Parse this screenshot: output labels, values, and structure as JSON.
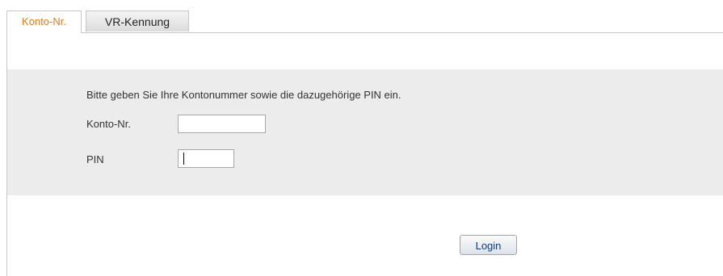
{
  "tabs": [
    {
      "label": "Konto-Nr.",
      "active": true,
      "color": "#e07b1f"
    },
    {
      "label": "VR-Kennung",
      "active": false
    }
  ],
  "form": {
    "instruction": "Bitte geben Sie Ihre Kontonummer sowie die dazugehörige PIN ein.",
    "account_label": "Konto-Nr.",
    "account_value": "",
    "pin_label": "PIN",
    "pin_value": "",
    "login_label": "Login"
  },
  "colors": {
    "panel_background": "#ececec",
    "login_text": "#123a78"
  }
}
